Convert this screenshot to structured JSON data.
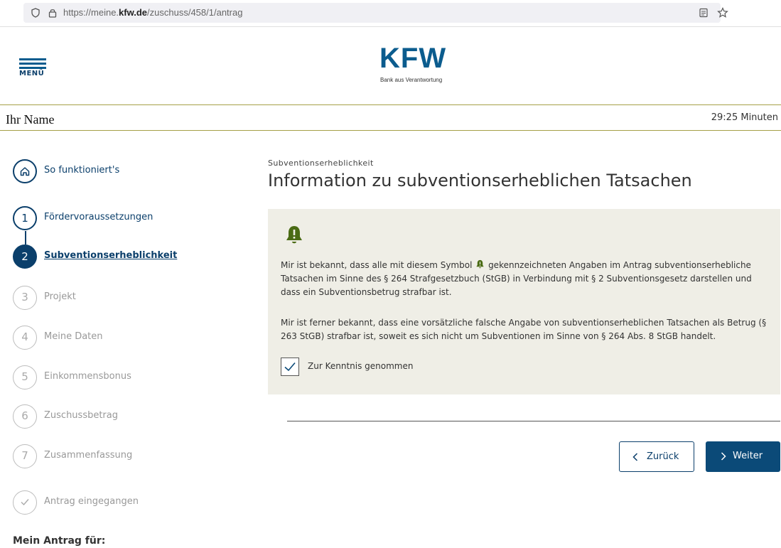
{
  "browser": {
    "url_prefix": "https://meine.",
    "url_domain": "kfw.de",
    "url_path": "/zuschuss/458/1/antrag"
  },
  "header": {
    "menu_label": "MENÜ",
    "logo_text": "KFW",
    "logo_tagline": "Bank aus Verantwortung"
  },
  "user_bar": {
    "name": "Ihr Name",
    "timer": "29:25 Minuten"
  },
  "sidebar": {
    "intro_label": "So funktioniert's",
    "steps": [
      {
        "number": "1",
        "label": "Fördervoraussetzungen",
        "state": "done"
      },
      {
        "number": "2",
        "label": "Subventionserheblichkeit",
        "state": "active"
      },
      {
        "number": "3",
        "label": "Projekt",
        "state": "pending"
      },
      {
        "number": "4",
        "label": "Meine Daten",
        "state": "pending"
      },
      {
        "number": "5",
        "label": "Einkommensbonus",
        "state": "pending"
      },
      {
        "number": "6",
        "label": "Zuschussbetrag",
        "state": "pending"
      },
      {
        "number": "7",
        "label": "Zusammenfassung",
        "state": "pending"
      }
    ],
    "final_label": "Antrag eingegangen",
    "footer_heading": "Mein Antrag für:"
  },
  "main": {
    "section_label": "Subventionserheblichkeit",
    "title": "Information zu subventionserheblichen Tatsachen",
    "paragraph1_before_icon": "Mir ist bekannt, dass alle mit diesem Symbol",
    "paragraph1_after_icon": "gekennzeichneten Angaben im Antrag subventionserhebliche Tatsachen im Sinne des § 264 Strafgesetzbuch (StGB) in Verbindung mit § 2 Subventionsgesetz darstellen und dass ein Subventionsbetrug strafbar ist.",
    "paragraph2": "Mir ist ferner bekannt, dass eine vorsätzliche falsche Angabe von subventionserheblichen Tatsachen als Betrug (§ 263 StGB) strafbar ist, soweit es sich nicht um Subventionen im Sinne von § 264 Abs. 8 StGB handelt.",
    "checkbox_label": "Zur Kenntnis genommen",
    "checkbox_checked": true,
    "back_label": "Zurück",
    "next_label": "Weiter"
  },
  "colors": {
    "brand_blue": "#0b4a78",
    "warning_green": "#4a6b14",
    "info_bg": "#efeee6",
    "rule_olive": "#a5a047"
  }
}
